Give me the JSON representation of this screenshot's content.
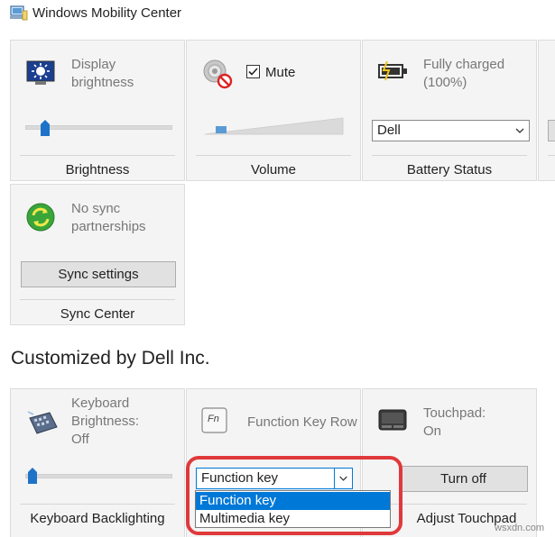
{
  "window": {
    "title": "Windows Mobility Center"
  },
  "tiles": {
    "brightness": {
      "label_line1": "Display",
      "label_line2": "brightness",
      "caption": "Brightness",
      "level": 0.15
    },
    "volume": {
      "mute_label": "Mute",
      "muted": true,
      "caption": "Volume",
      "level": 0.08
    },
    "battery": {
      "label_line1": "Fully charged",
      "label_line2": "(100%)",
      "plan_value": "Dell",
      "caption": "Battery Status"
    },
    "sync": {
      "label_line1": "No sync",
      "label_line2": "partnerships",
      "button_label": "Sync settings",
      "caption": "Sync Center"
    }
  },
  "section": {
    "heading": "Customized by Dell Inc."
  },
  "dell_tiles": {
    "keyboard": {
      "label_line1": "Keyboard",
      "label_line2": "Brightness:",
      "label_line3": "Off",
      "caption": "Keyboard Backlighting",
      "level": 0.02
    },
    "fnrow": {
      "icon_text": "Fn",
      "label": "Function Key Row",
      "selected": "Function key",
      "options": [
        "Function key",
        "Multimedia key"
      ]
    },
    "touchpad": {
      "label_line1": "Touchpad:",
      "label_line2": "On",
      "button_label": "Turn off",
      "caption": "Adjust Touchpad"
    }
  },
  "colors": {
    "accent": "#0078d7",
    "thumb": "#1e73c9",
    "highlight": "#e0393b",
    "sync_green": "#3aa63a"
  },
  "watermark": "wsxdn.com"
}
